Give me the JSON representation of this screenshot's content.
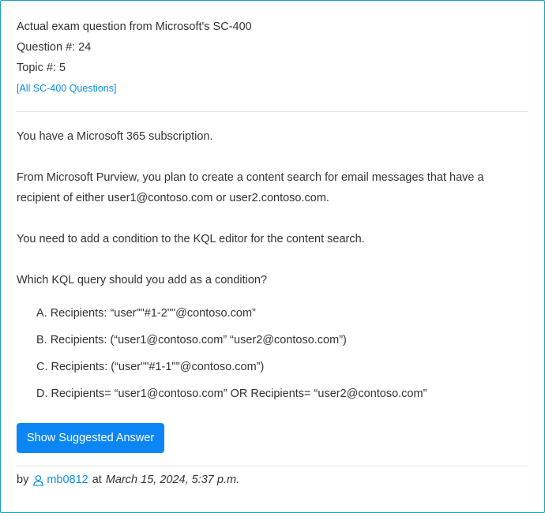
{
  "header": {
    "title": "Actual exam question from Microsoft's SC-400",
    "question_number": "Question #: 24",
    "topic_number": "Topic #: 5",
    "all_questions_link": "[All SC-400 Questions]"
  },
  "question": {
    "paragraphs": [
      "You have a Microsoft 365 subscription.",
      "From Microsoft Purview, you plan to create a content search for email messages that have a recipient of either user1@contoso.com or user2.contoso.com.",
      "You need to add a condition to the KQL editor for the content search.",
      "Which KQL query should you add as a condition?"
    ],
    "choices": [
      {
        "letter": "A.",
        "text": "Recipients: “user\"\"#1-2\"\"@contoso.com”"
      },
      {
        "letter": "B.",
        "text": "Recipients: (“user1@contoso.com” “user2@contoso.com”)"
      },
      {
        "letter": "C.",
        "text": "Recipients: (“user\"\"#1-1\"\"@contoso.com”)"
      },
      {
        "letter": "D.",
        "text": "Recipients= “user1@contoso.com” OR Recipients= “user2@contoso.com”"
      }
    ]
  },
  "actions": {
    "show_answer_label": "Show Suggested Answer"
  },
  "footer": {
    "by_label": "by",
    "user_icon": "user-outline-icon",
    "username": "mb0812",
    "at_label": "at",
    "timestamp": "March 15, 2024, 5:37 p.m."
  },
  "colors": {
    "border": "#17a2b8",
    "link": "#0d8ee6",
    "button": "#0d86f5",
    "text": "#333333"
  }
}
